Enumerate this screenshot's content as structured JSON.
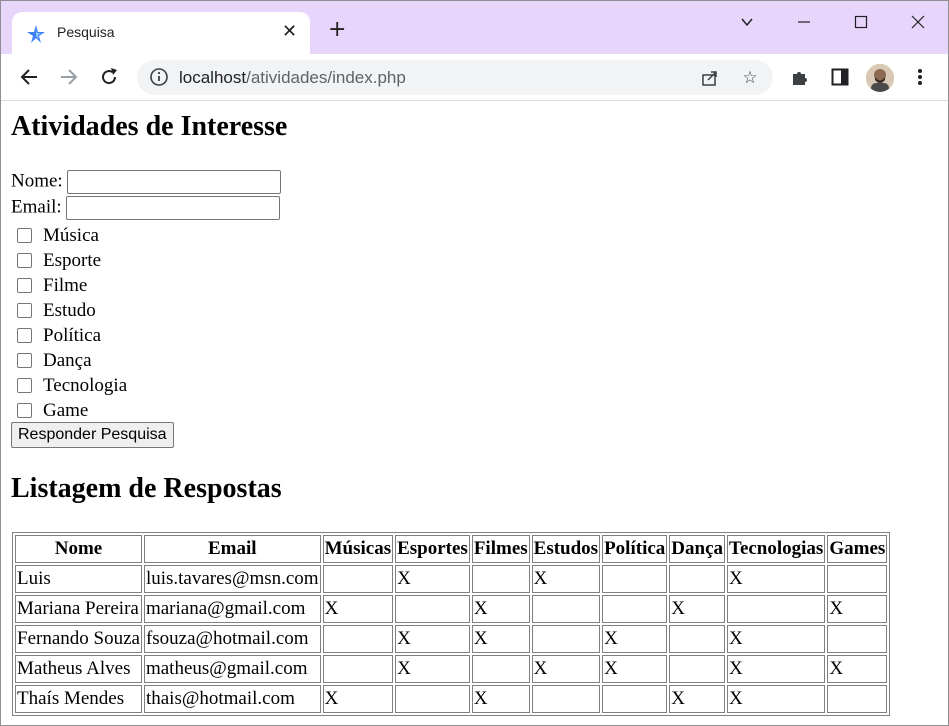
{
  "browser": {
    "tab_title": "Pesquisa",
    "url_host": "localhost",
    "url_path": "/atividades/index.php"
  },
  "page": {
    "heading": "Atividades de Interesse",
    "form": {
      "nome_label": "Nome:",
      "nome_value": "",
      "email_label": "Email:",
      "email_value": "",
      "options": [
        "Música",
        "Esporte",
        "Filme",
        "Estudo",
        "Política",
        "Dança",
        "Tecnologia",
        "Game"
      ],
      "submit_label": "Responder Pesquisa"
    },
    "list_heading": "Listagem de Respostas",
    "table": {
      "headers": [
        "Nome",
        "Email",
        "Músicas",
        "Esportes",
        "Filmes",
        "Estudos",
        "Política",
        "Dança",
        "Tecnologias",
        "Games"
      ],
      "rows": [
        [
          "Luis",
          "luis.tavares@msn.com",
          "",
          "X",
          "",
          "X",
          "",
          "",
          "X",
          ""
        ],
        [
          "Mariana Pereira",
          "mariana@gmail.com",
          "X",
          "",
          "X",
          "",
          "",
          "X",
          "",
          "X"
        ],
        [
          "Fernando Souza",
          "fsouza@hotmail.com",
          "",
          "X",
          "X",
          "",
          "X",
          "",
          "X",
          ""
        ],
        [
          "Matheus Alves",
          "matheus@gmail.com",
          "",
          "X",
          "",
          "X",
          "X",
          "",
          "X",
          "X"
        ],
        [
          "Thaís Mendes",
          "thais@hotmail.com",
          "X",
          "",
          "X",
          "",
          "",
          "X",
          "X",
          ""
        ]
      ]
    }
  }
}
